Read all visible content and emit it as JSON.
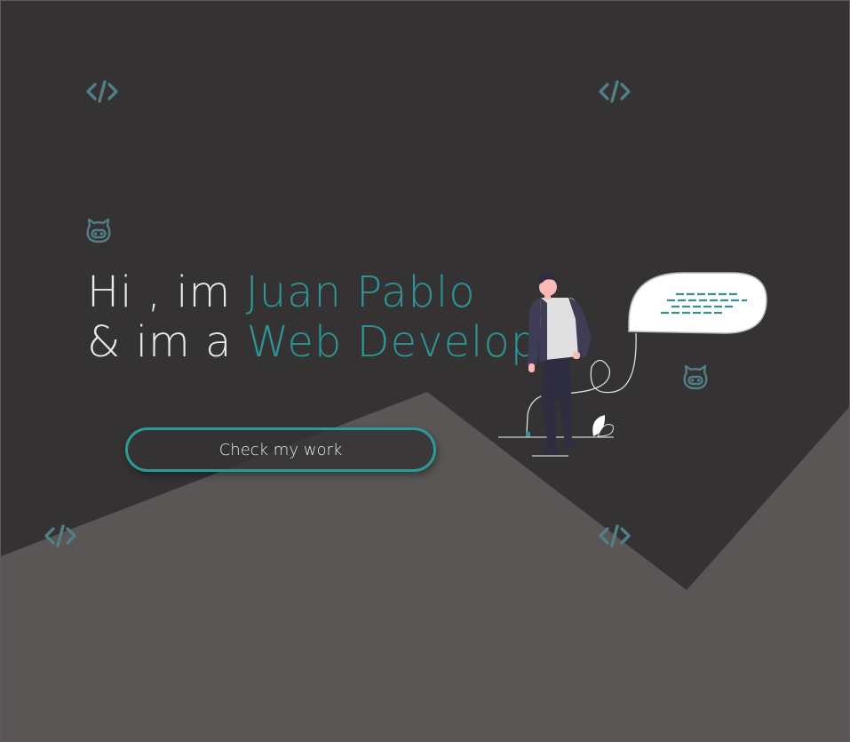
{
  "hero": {
    "greeting": "Hi , im ",
    "name": "Juan Pablo",
    "role_prefix": "& im a ",
    "role": "Web Developer"
  },
  "cta": {
    "label": "Check my work"
  },
  "colors": {
    "background": "#343233",
    "mountain": "#595655",
    "accent": "#2f9394",
    "text": "#e8e8e8",
    "icon": "#527f86"
  },
  "icons": {
    "code": "code-brackets-icon",
    "github": "github-octocat-icon"
  }
}
